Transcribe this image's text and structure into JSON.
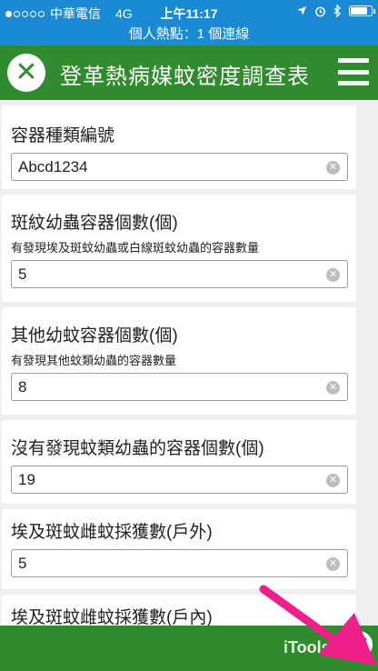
{
  "status_bar": {
    "carrier": "中華電信",
    "network": "4G",
    "time": "上午11:17"
  },
  "hotspot": "個人熱點：1 個連線",
  "header": {
    "title": "登革熱病媒蚊密度調查表",
    "close_icon": "close-icon",
    "menu_icon": "hamburger-menu-icon"
  },
  "form": {
    "fields": [
      {
        "label": "容器種類編號",
        "hint": "",
        "value": "Abcd1234"
      },
      {
        "label": "斑紋幼蟲容器個數(個)",
        "hint": "有發現埃及斑蚊幼蟲或白線斑蚊幼蟲的容器數量",
        "value": "5"
      },
      {
        "label": "其他幼蚊容器個數(個)",
        "hint": "有發現其他蚊類幼蟲的容器數量",
        "value": "8"
      },
      {
        "label": "沒有發現蚊類幼蟲的容器個數(個)",
        "hint": "",
        "value": "19"
      },
      {
        "label": "埃及斑蚊雌蚊採獲數(戶外)",
        "hint": "",
        "value": "5"
      },
      {
        "label": "埃及斑蚊雌蚊採獲數(戶內)",
        "hint": "",
        "value": ""
      }
    ]
  },
  "bottom_bar": {
    "watermark": "iTools",
    "submit_icon": "check-icon"
  },
  "colors": {
    "status_blue": "#1a8ad4",
    "brand_green": "#2f8b2d",
    "annotation_arrow": "#ee1f8a"
  }
}
